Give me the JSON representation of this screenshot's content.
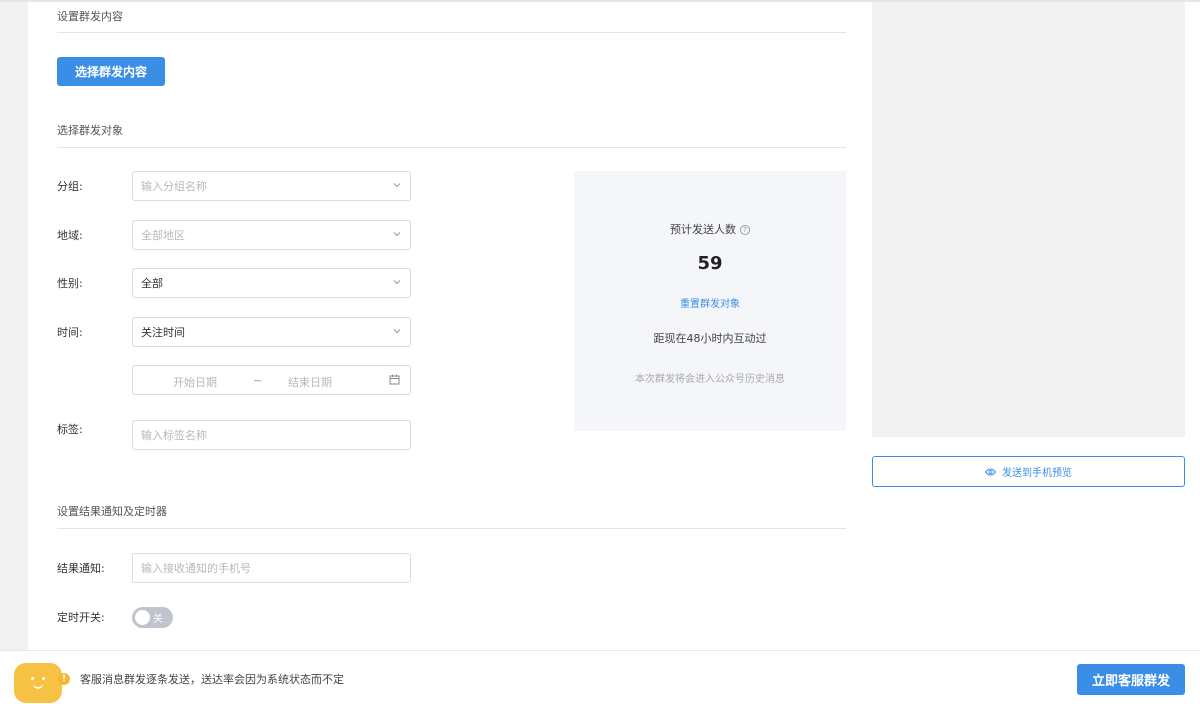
{
  "sections": {
    "content_title": "设置群发内容",
    "target_title": "选择群发对象",
    "notify_title": "设置结果通知及定时器"
  },
  "buttons": {
    "select_content": "选择群发内容",
    "preview_phone": "发送到手机预览",
    "send_now": "立即客服群发"
  },
  "filters": {
    "group": {
      "label": "分组:",
      "placeholder": "输入分组名称"
    },
    "region": {
      "label": "地域:",
      "placeholder": "全部地区"
    },
    "gender": {
      "label": "性别:",
      "value": "全部"
    },
    "time": {
      "label": "时间:",
      "value": "关注时间"
    },
    "date_range": {
      "start_placeholder": "开始日期",
      "separator": "~",
      "end_placeholder": "结束日期"
    },
    "tag": {
      "label": "标签:",
      "placeholder": "输入标签名称"
    }
  },
  "stats": {
    "estimate_label": "预计发送人数",
    "estimate_count": "59",
    "reset_link": "重置群发对象",
    "interaction_note": "距现在48小时内互动过",
    "history_note": "本次群发将会进入公众号历史消息"
  },
  "notify": {
    "result_label": "结果通知:",
    "result_placeholder": "输入接收通知的手机号",
    "timer_label": "定时开关:",
    "timer_state": "关"
  },
  "footer": {
    "notice": "客服消息群发逐条发送，送达率会因为系统状态而不定"
  },
  "colors": {
    "primary": "#3a8ee6",
    "warning": "#f7b731",
    "mascot": "#f7c244"
  }
}
